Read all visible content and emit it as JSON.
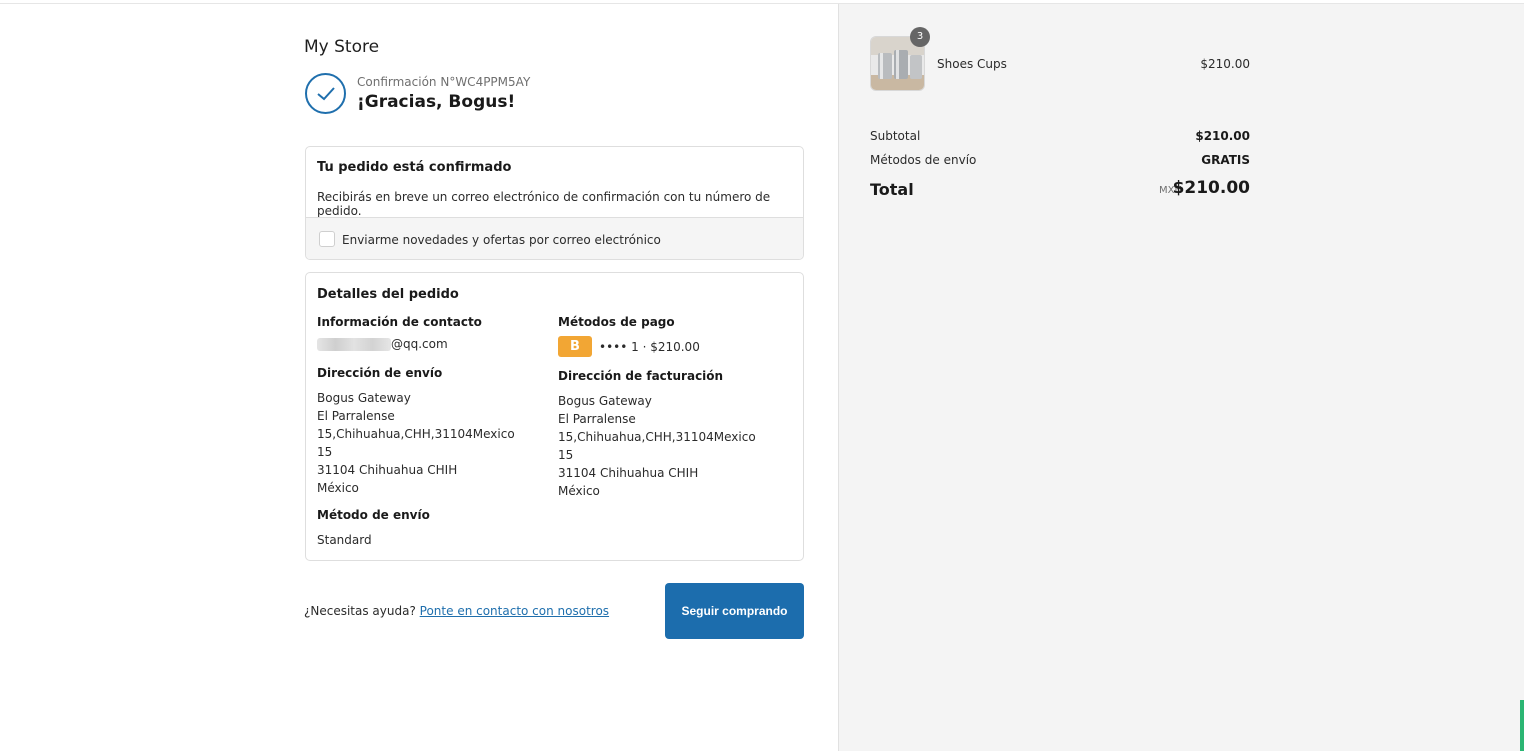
{
  "store": {
    "name": "My Store"
  },
  "confirmation": {
    "number_label": "Confirmación N°WC4PPM5AY",
    "thanks": "¡Gracias, Bogus!"
  },
  "order_confirmed": {
    "title": "Tu pedido está confirmado",
    "description": "Recibirás en breve un correo electrónico de confirmación con tu número de pedido.",
    "optin_label": "Enviarme novedades y ofertas por correo electrónico",
    "optin_checked": false
  },
  "order_details": {
    "title": "Detalles del pedido",
    "contact": {
      "heading": "Información de contacto",
      "email_visible": "@qq.com"
    },
    "payment": {
      "heading": "Métodos de pago",
      "badge": "B",
      "text": "•••• 1 · $210.00",
      "badge_color": "#f2a634"
    },
    "shipping_address": {
      "heading": "Dirección de envío",
      "lines": [
        "Bogus Gateway",
        "El Parralense",
        "15,Chihuahua,CHH,31104Mexico",
        "15",
        "31104 Chihuahua CHIH",
        "México"
      ]
    },
    "billing_address": {
      "heading": "Dirección de facturación",
      "lines": [
        "Bogus Gateway",
        "El Parralense",
        "15,Chihuahua,CHH,31104Mexico",
        "15",
        "31104 Chihuahua CHIH",
        "México"
      ]
    },
    "shipping_method": {
      "heading": "Método de envío",
      "value": "Standard"
    }
  },
  "footer": {
    "help_text": "¿Necesitas ayuda?",
    "help_link": "Ponte en contacto con nosotros",
    "continue_button": "Seguir comprando"
  },
  "summary": {
    "item": {
      "name": "Shoes Cups",
      "price": "$210.00",
      "quantity": "3"
    },
    "subtotal_label": "Subtotal",
    "subtotal_value": "$210.00",
    "shipping_label": "Métodos de envío",
    "shipping_value": "GRATIS",
    "total_label": "Total",
    "currency": "MXN",
    "total_value": "$210.00"
  },
  "colors": {
    "accent": "#1c6dad",
    "sidebar_bg": "#f4f4f4"
  }
}
